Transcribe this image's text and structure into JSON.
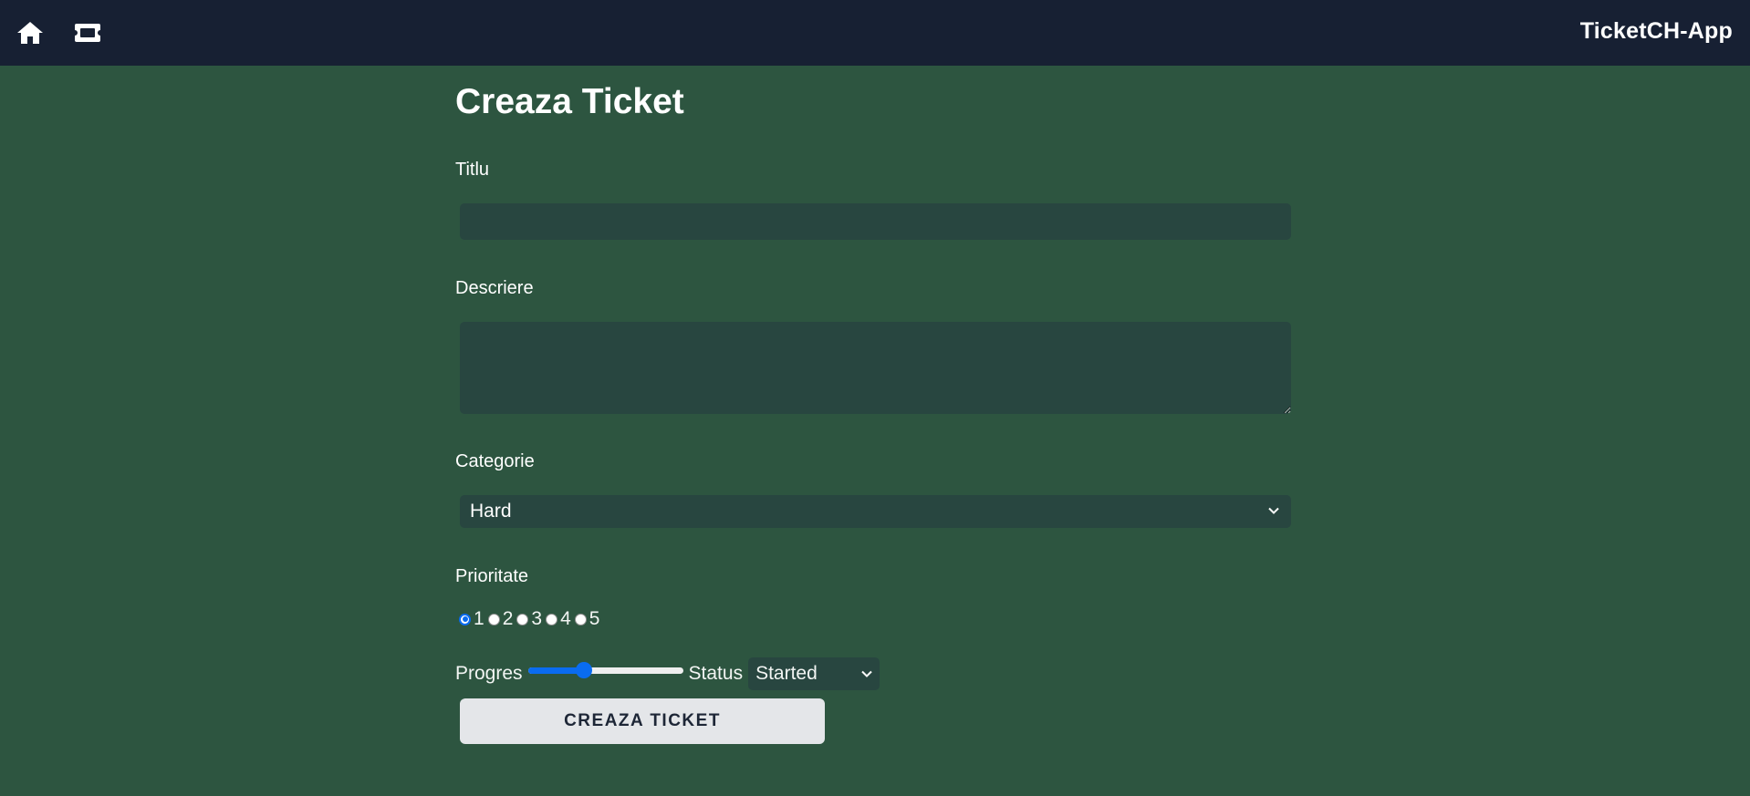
{
  "app": {
    "brand": "TicketCH-App",
    "colors": {
      "navbar_bg": "#172033",
      "page_bg": "#2d5540",
      "field_bg": "#284640",
      "accent": "#0a6cf0",
      "button_bg": "#e4e6e9"
    }
  },
  "nav": {
    "icons": [
      "home-icon",
      "ticket-icon"
    ]
  },
  "form": {
    "title": "Creaza Ticket",
    "titlu_label": "Titlu",
    "titlu_value": "",
    "descriere_label": "Descriere",
    "descriere_value": "",
    "categorie_label": "Categorie",
    "categorie_value": "Hard",
    "prioritate_label": "Prioritate",
    "prioritate_options": [
      "1",
      "2",
      "3",
      "4",
      "5"
    ],
    "prioritate_selected": "1",
    "progres_label": "Progres",
    "progres_value": 0.36,
    "status_label": "Status",
    "status_value": "Started",
    "submit_label": "Creaza Ticket"
  }
}
